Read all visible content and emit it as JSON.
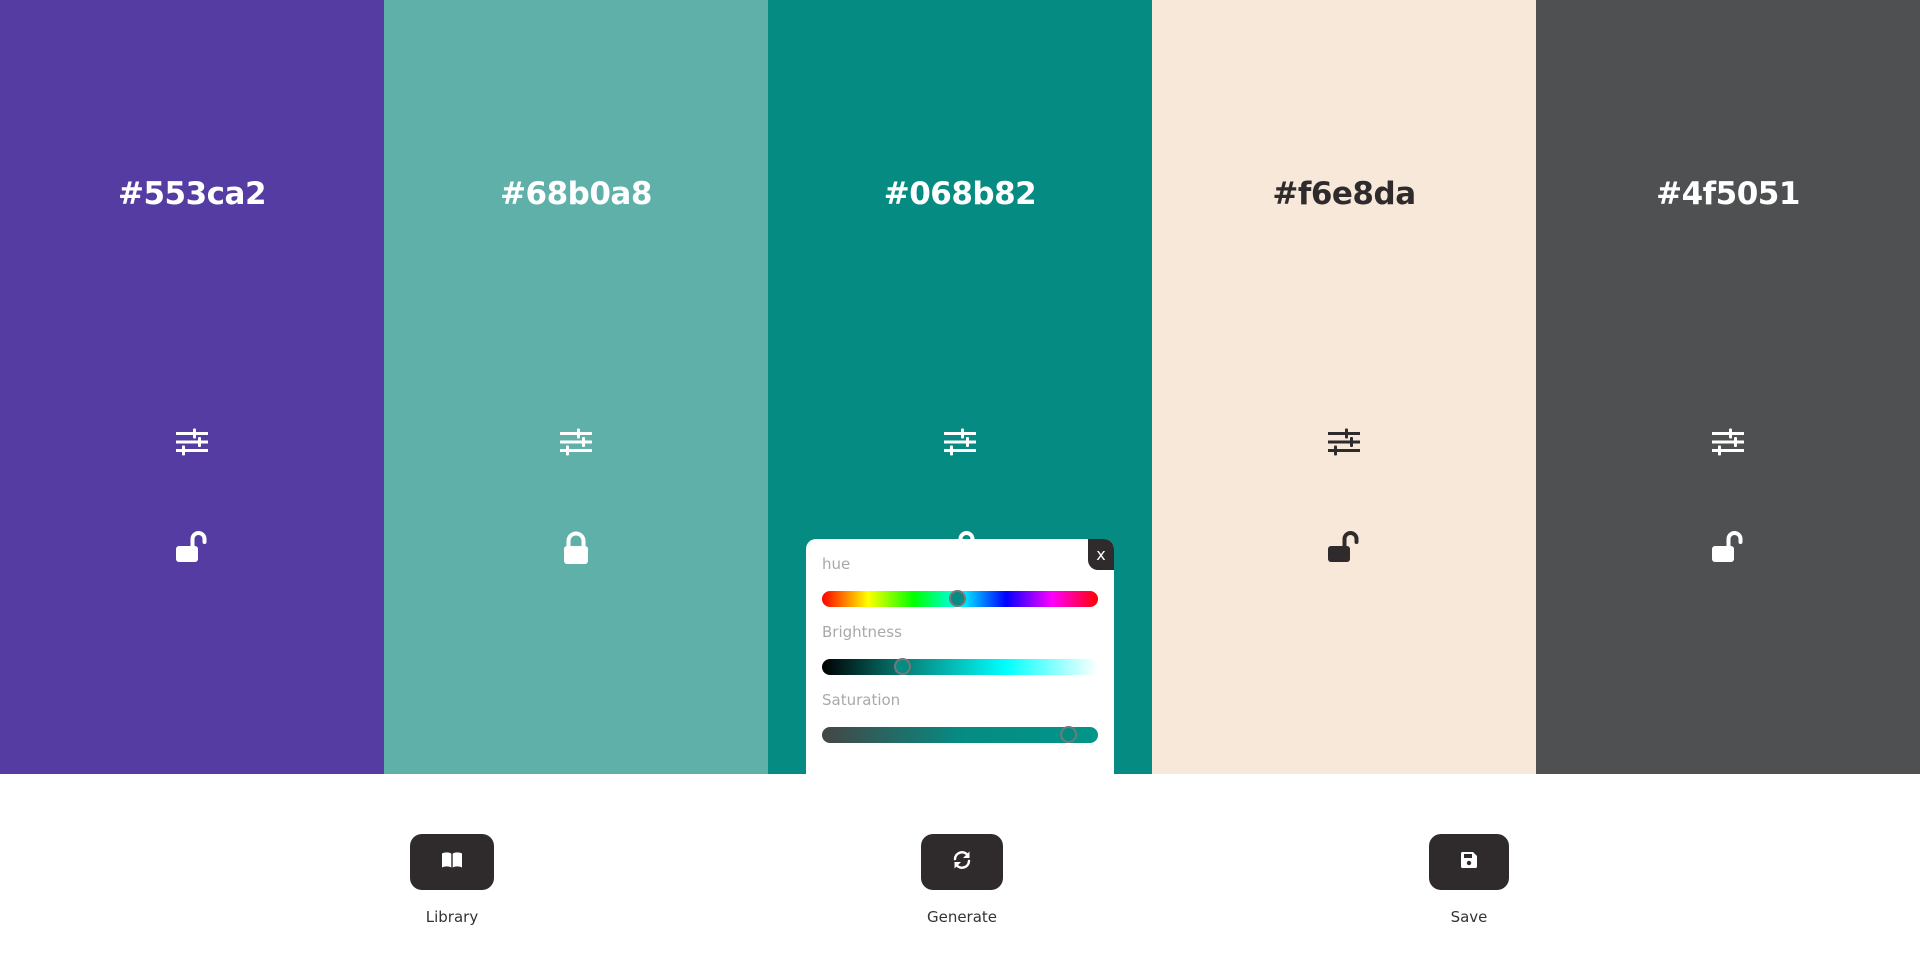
{
  "palette": [
    {
      "hex": "#553ca2",
      "bg": "#553ca2",
      "fg": "#ffffff",
      "locked": false
    },
    {
      "hex": "#68b0a8",
      "bg": "#5fb0a8",
      "fg": "#ffffff",
      "locked": true
    },
    {
      "hex": "#068b82",
      "bg": "#068b82",
      "fg": "#ffffff",
      "locked": false
    },
    {
      "hex": "#f6e8da",
      "bg": "#f7e8da",
      "fg": "#2f2b2c",
      "locked": false
    },
    {
      "hex": "#4f5051",
      "bg": "#4f5051",
      "fg": "#ffffff",
      "locked": false
    }
  ],
  "picker": {
    "close_label": "x",
    "hue_label": "hue",
    "brightness_label": "Brightness",
    "saturation_label": "Saturation",
    "hue_value": 0.49,
    "brightness_value": 0.29,
    "saturation_value": 0.89,
    "brightness_gradient": [
      "#000000",
      "#068b82",
      "#00ffff",
      "#ffffff"
    ],
    "saturation_gradient": [
      "#454545",
      "#068b82",
      "#00968a"
    ]
  },
  "controls": {
    "library_label": "Library",
    "generate_label": "Generate",
    "save_label": "Save"
  },
  "icons": {
    "adjust": "sliders-icon",
    "lock_open": "unlock-icon",
    "lock_closed": "lock-icon",
    "library": "book-icon",
    "generate": "refresh-icon",
    "save": "floppy-disk-icon"
  }
}
